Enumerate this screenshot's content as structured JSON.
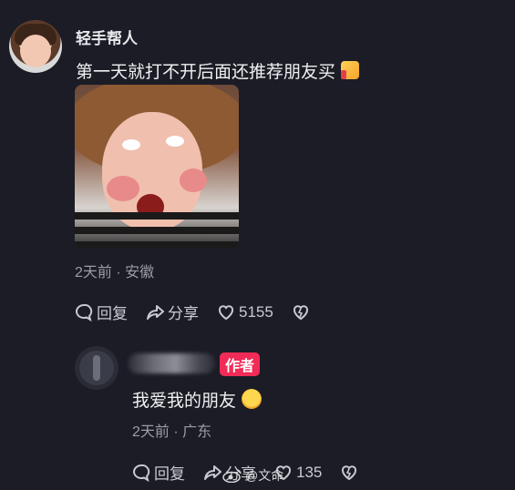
{
  "comment": {
    "username": "轻手帮人",
    "text": "第一天就打不开后面还推荐朋友买",
    "emoji": "thumbs-up-emoji",
    "meta": "2天前 · 安徽",
    "actions": {
      "reply": "回复",
      "share": "分享",
      "likes": "5155"
    }
  },
  "reply": {
    "badge": "作者",
    "text": "我爱我的朋友",
    "emoji": "laughing-emoji",
    "meta": "2天前 · 广东",
    "actions": {
      "reply": "回复",
      "share": "分享",
      "likes": "135"
    }
  },
  "watermark": {
    "text": "@文命"
  },
  "colors": {
    "background": "#1b1c25",
    "badge": "#f02b57",
    "meta": "#9b9ca4"
  }
}
